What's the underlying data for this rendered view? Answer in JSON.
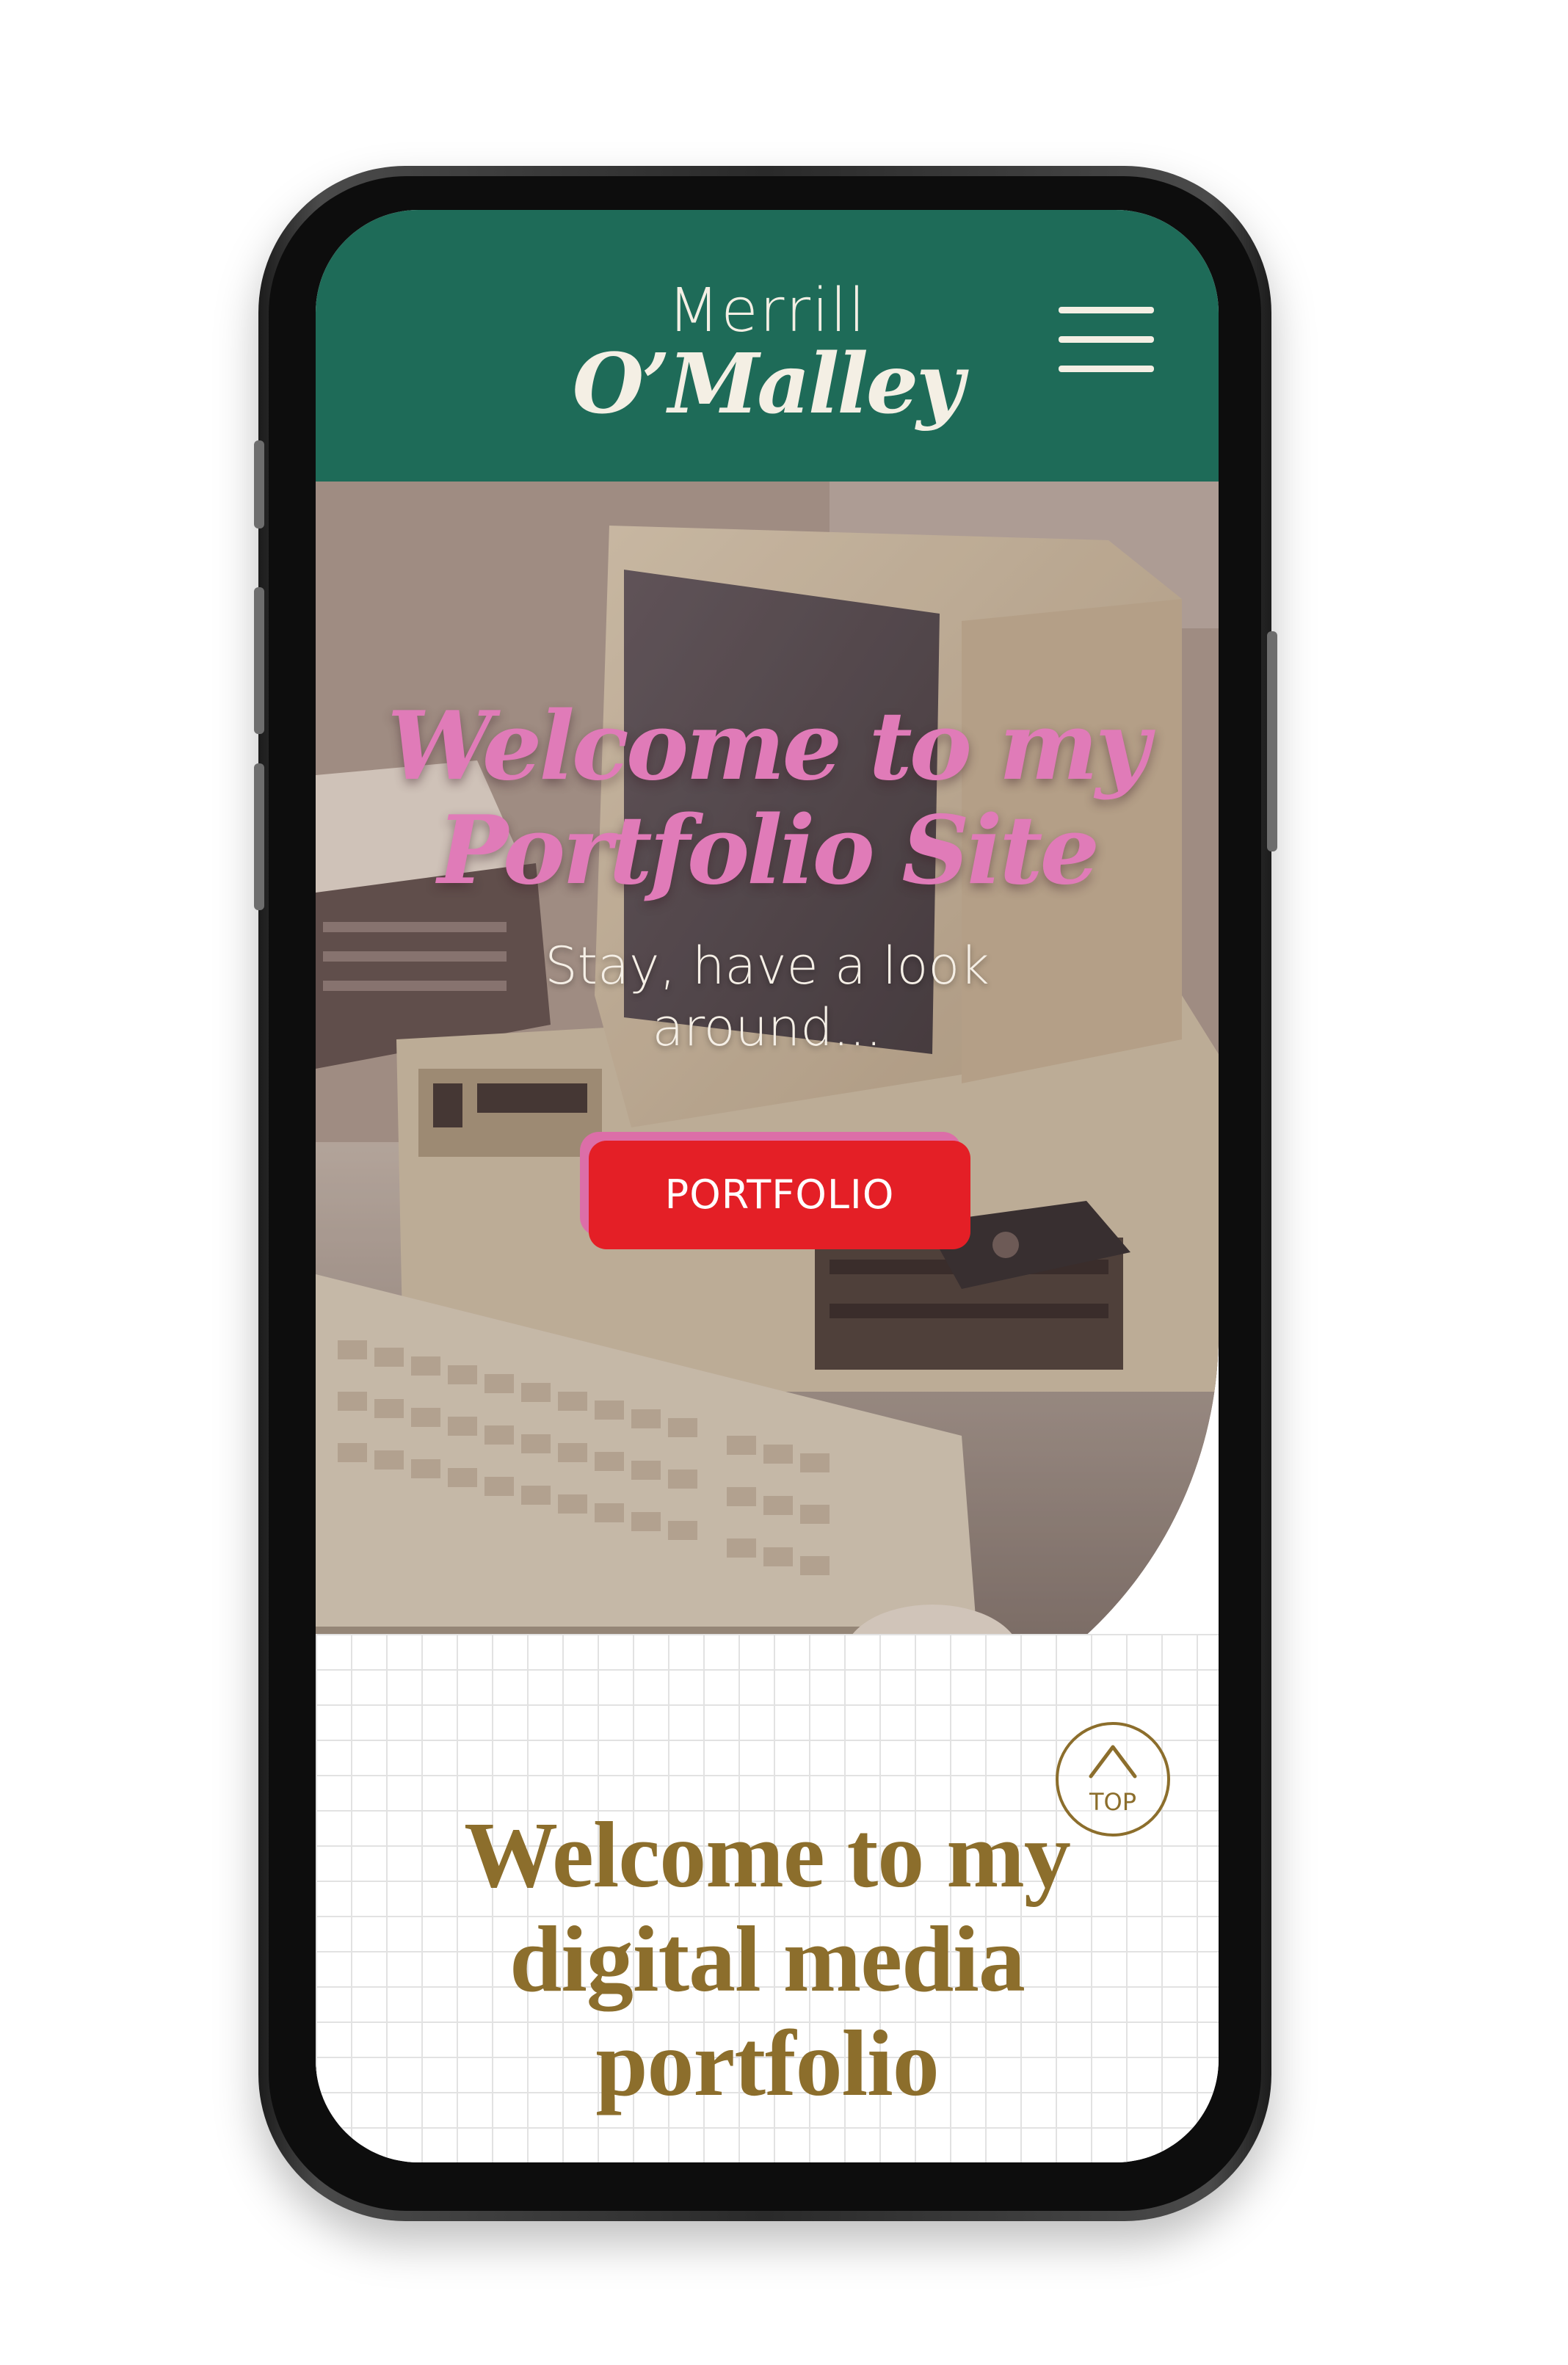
{
  "colors": {
    "header_bg": "#1e6b58",
    "brand_text": "#f4efe4",
    "hero_title": "#e07bb8",
    "cta_bg": "#e41f26",
    "cta_shadow": "#dc6ea8",
    "accent_gold": "#8c6e2c"
  },
  "header": {
    "brand_first": "Merrill",
    "brand_last": "O’Malley",
    "menu_icon": "hamburger-menu-icon"
  },
  "hero": {
    "title_line1": "Welcome to my",
    "title_line2": "Portfolio Site",
    "subtitle_line1": "Stay, have a look",
    "subtitle_line2": "around...",
    "cta_label": "PORTFOLIO"
  },
  "back_to_top": {
    "icon": "chevron-up-icon",
    "label": "TOP"
  },
  "intro": {
    "line1": "Welcome to my",
    "line2": "digital media",
    "line3": "portfolio"
  }
}
